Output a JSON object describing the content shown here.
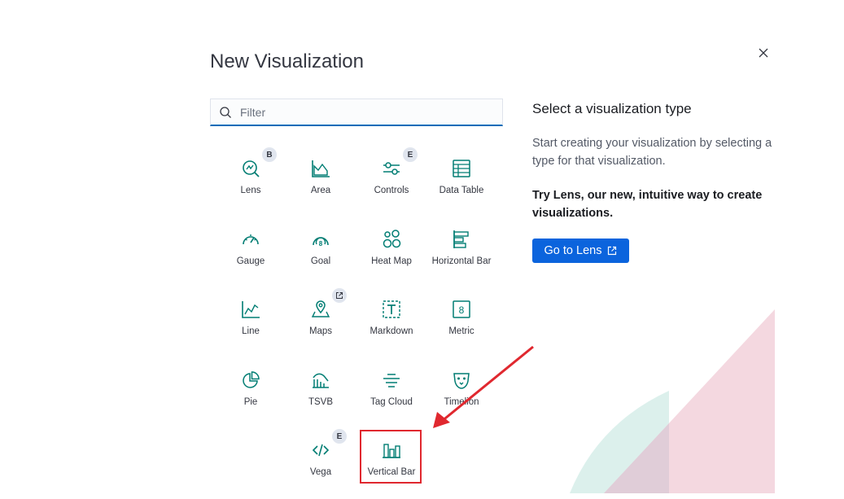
{
  "modal": {
    "title": "New Visualization",
    "close_icon": "close-icon"
  },
  "search": {
    "placeholder": "Filter",
    "icon": "search-icon"
  },
  "types": [
    {
      "label": "Lens",
      "icon": "lens-icon",
      "badge": "B"
    },
    {
      "label": "Area",
      "icon": "area-chart-icon"
    },
    {
      "label": "Controls",
      "icon": "controls-icon",
      "badge": "E"
    },
    {
      "label": "Data Table",
      "icon": "data-table-icon"
    },
    {
      "label": "Gauge",
      "icon": "gauge-icon"
    },
    {
      "label": "Goal",
      "icon": "goal-icon"
    },
    {
      "label": "Heat Map",
      "icon": "heat-map-icon"
    },
    {
      "label": "Horizontal Bar",
      "icon": "horizontal-bar-icon"
    },
    {
      "label": "Line",
      "icon": "line-chart-icon"
    },
    {
      "label": "Maps",
      "icon": "maps-icon",
      "badge": "external-link-icon"
    },
    {
      "label": "Markdown",
      "icon": "markdown-icon"
    },
    {
      "label": "Metric",
      "icon": "metric-icon"
    },
    {
      "label": "Pie",
      "icon": "pie-chart-icon"
    },
    {
      "label": "TSVB",
      "icon": "tsvb-icon"
    },
    {
      "label": "Tag Cloud",
      "icon": "tag-cloud-icon"
    },
    {
      "label": "Timelion",
      "icon": "timelion-icon"
    },
    {
      "label": "Vega",
      "icon": "vega-icon",
      "badge": "E"
    },
    {
      "label": "Vertical Bar",
      "icon": "vertical-bar-icon"
    }
  ],
  "side": {
    "heading": "Select a visualization type",
    "description": "Start creating your visualization by selecting a type for that visualization.",
    "lens_pitch": "Try Lens, our new, intuitive way to create visualizations.",
    "lens_button": "Go to Lens",
    "lens_button_icon": "external-link-icon"
  },
  "colors": {
    "icon": "#017d73",
    "primary": "#0b64dd",
    "highlight": "#e0282f",
    "badge": "#e0e5ee",
    "deco_pink": "#f3d4dd",
    "deco_teal": "#d6ede9"
  }
}
